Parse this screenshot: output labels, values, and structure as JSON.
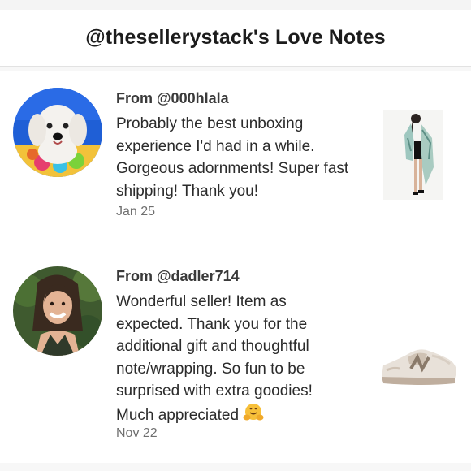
{
  "header": {
    "title": "@thesellerystack's Love Notes"
  },
  "notes": [
    {
      "from": "From @000hlala",
      "message": "Probably the best unboxing experience I'd had in a while. Gorgeous adornments! Super fast shipping! Thank you!",
      "date": "Jan 25",
      "avatar_icon": "dog-avatar-icon",
      "thumb_icon": "kimono-product-thumbnail-icon"
    },
    {
      "from": "From @dadler714",
      "message": "Wonderful seller! Item as expected. Thank you for the additional gift and thoughtful note/wrapping. So fun to be surprised with extra goodies! Much appreciated",
      "date": "Nov 22",
      "avatar_icon": "woman-avatar-icon",
      "thumb_icon": "sneaker-product-thumbnail-icon",
      "emoji_icon": "hugging-face-emoji-icon"
    }
  ],
  "colors": {
    "text": "#2b2b2b",
    "muted": "#6f6f6f",
    "divider": "#e6e6e6",
    "avatar_blue": "#1f5fd6"
  }
}
